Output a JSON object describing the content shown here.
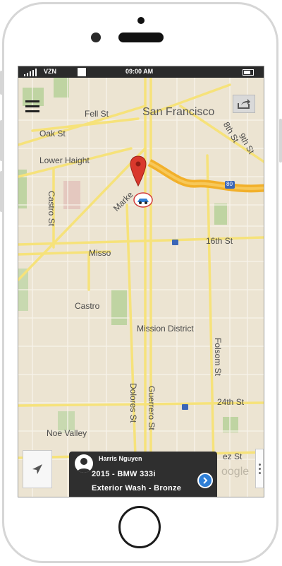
{
  "status_bar": {
    "carrier": "VZN",
    "time": "09:00 AM"
  },
  "map": {
    "labels": {
      "fell_st": "Fell St",
      "san_francisco": "San Francisco",
      "oak_st": "Oak St",
      "lower_haight": "Lower Haight",
      "castro_st": "Castro St",
      "market": "Marke",
      "mission_st": "Misso",
      "sixteenth_st": "16th St",
      "castro": "Castro",
      "mission_district": "Mission District",
      "folsom_st": "Folsom St",
      "dolores_st": "Dolores St",
      "guerrero_st": "Guerrero St",
      "twentyfourth_st": "24th St",
      "noe_valley": "Noe Valley",
      "eighth_st": "8th St",
      "ninth_st": "9th St",
      "highway": "80",
      "cesar_chavez": "ez St",
      "watermark": "oogle"
    }
  },
  "card": {
    "driver_name": "Harris Nguyen",
    "vehicle": "2015 - BMW 333i",
    "service": "Exterior Wash - Bronze"
  },
  "icons": {
    "menu": "menu-icon",
    "share": "share-icon",
    "locate": "location-arrow-icon",
    "more": "more-vertical-icon",
    "avatar": "user-avatar-icon",
    "go": "chevron-right-icon",
    "pin": "map-pin-icon",
    "logo": "car-wash-logo-icon"
  },
  "colors": {
    "pin": "#d9382c",
    "route": "#f2b02a",
    "accent": "#2f7fd6",
    "card": "#2f2f2f"
  }
}
